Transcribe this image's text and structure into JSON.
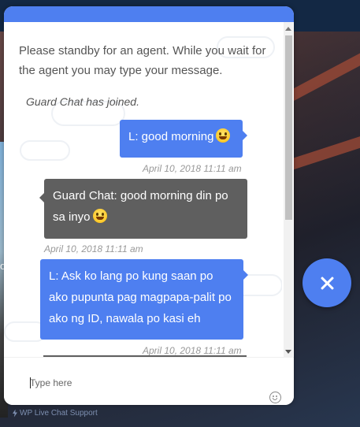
{
  "chat": {
    "intro": "Please standby for an agent. While you wait for the agent you may type your message.",
    "joined": "Guard Chat has joined.",
    "messages": [
      {
        "from": "visitor",
        "text": "L: good morning",
        "emoji": "grinning-face",
        "time": "April 10, 2018 11:11 am"
      },
      {
        "from": "agent",
        "text": "Guard Chat: good morning din po sa inyo",
        "emoji": "smiling-face",
        "time": "April 10, 2018 11:11 am"
      },
      {
        "from": "visitor",
        "text": "L: Ask ko lang po kung saan po ako pupunta pag magpapa-palit po ako ng ID, nawala po kasi eh",
        "time": "April 10, 2018 11:11 am"
      }
    ],
    "input_placeholder": "Type here"
  },
  "branding": {
    "powered_by": "WP Live Chat Support"
  },
  "colors": {
    "accent": "#4e7ff0",
    "agent_bubble": "#5f5f5f",
    "timestamp": "#999999"
  },
  "icons": {
    "close": "close-icon",
    "emoji": "smiley-icon",
    "powered": "bolt-icon"
  }
}
